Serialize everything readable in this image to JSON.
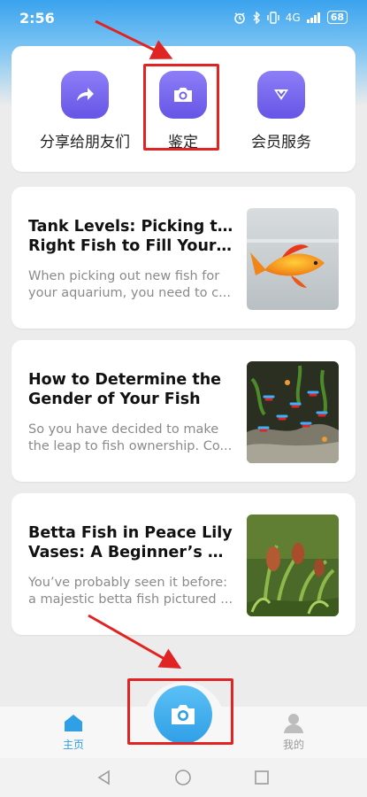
{
  "status_bar": {
    "time": "2:56",
    "network": "4G",
    "battery": "68"
  },
  "quick_actions": [
    {
      "label": "分享给朋友们",
      "icon": "share-arrow-icon"
    },
    {
      "label": "鉴定",
      "icon": "camera-icon"
    },
    {
      "label": "会员服务",
      "icon": "vip-heart-icon"
    }
  ],
  "articles": [
    {
      "title_line1": "Tank Levels: Picking the",
      "title_line2": "Right Fish to Fill Your A...",
      "excerpt_line1": "When picking out new fish for",
      "excerpt_line2": "your aquarium, you need to c..."
    },
    {
      "title_line1": "How to Determine the",
      "title_line2": "Gender of Your Fish",
      "excerpt_line1": "So you have decided to make",
      "excerpt_line2": "the leap to fish ownership. Co..."
    },
    {
      "title_line1": "Betta Fish in Peace Lily",
      "title_line2": "Vases: A Beginner’s Mist...",
      "excerpt_line1": "You’ve probably seen it before:",
      "excerpt_line2": "a majestic betta fish pictured ..."
    }
  ],
  "tab_bar": {
    "home_label": "主页",
    "me_label": "我的",
    "center_icon": "camera-icon"
  },
  "colors": {
    "accent_blue": "#2f9fe6",
    "icon_purple": "#6f5ff0",
    "highlight_red": "#e02424"
  }
}
